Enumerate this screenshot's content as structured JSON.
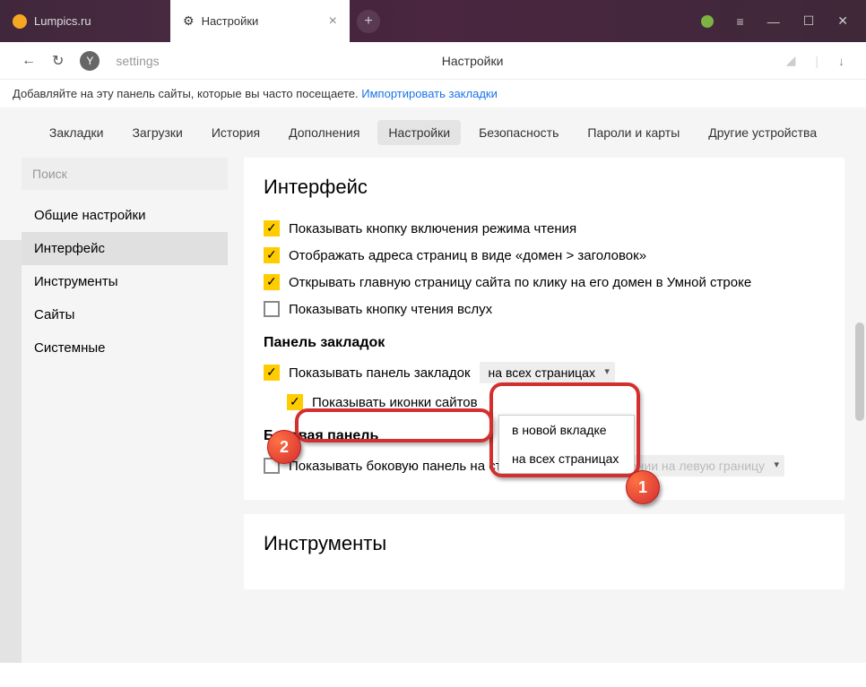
{
  "titlebar": {
    "tab1_label": "Lumpics.ru",
    "tab2_label": "Настройки"
  },
  "addrbar": {
    "url_text": "settings",
    "page_title": "Настройки"
  },
  "hint": {
    "text": "Добавляйте на эту панель сайты, которые вы часто посещаете.",
    "link": "Импортировать закладки"
  },
  "topnav": {
    "items": [
      "Закладки",
      "Загрузки",
      "История",
      "Дополнения",
      "Настройки",
      "Безопасность",
      "Пароли и карты",
      "Другие устройства"
    ],
    "active": "Настройки"
  },
  "sidebar": {
    "search_placeholder": "Поиск",
    "items": [
      "Общие настройки",
      "Интерфейс",
      "Инструменты",
      "Сайты",
      "Системные"
    ],
    "active": "Интерфейс"
  },
  "interface": {
    "title": "Интерфейс",
    "opts": [
      {
        "checked": true,
        "label": "Показывать кнопку включения режима чтения"
      },
      {
        "checked": true,
        "label": "Отображать адреса страниц в виде «домен > заголовок»"
      },
      {
        "checked": true,
        "label": "Открывать главную страницу сайта по клику на его домен в Умной строке"
      },
      {
        "checked": false,
        "label": "Показывать кнопку чтения вслух"
      }
    ],
    "bookmarks_hdr": "Панель закладок",
    "show_panel_label": "Показывать панель закладок",
    "show_panel_select": "на всех страницах",
    "show_icons_label": "Показывать иконки сайтов",
    "dropdown_opts": [
      "в новой вкладке",
      "на всех страницах"
    ],
    "side_hdr": "Боковая панель",
    "side_label": "Показывать боковую панель на страницах",
    "side_select": "при наведении на левую границу"
  },
  "tools": {
    "title": "Инструменты"
  },
  "callouts": {
    "one": "1",
    "two": "2"
  }
}
